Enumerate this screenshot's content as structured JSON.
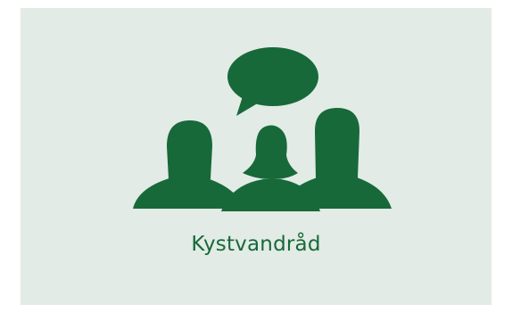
{
  "tile": {
    "label": "Kystvandråd",
    "icon": "people-discussion-icon",
    "accent_color": "#17693a",
    "background_color": "#e2ebe5"
  }
}
